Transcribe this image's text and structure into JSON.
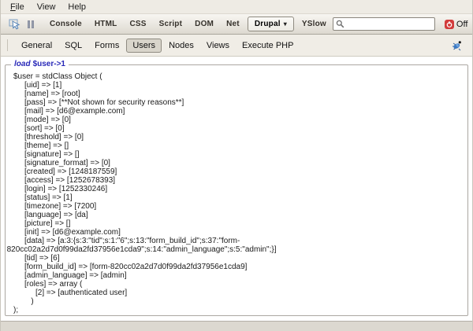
{
  "menu": {
    "items": [
      {
        "label": "File",
        "mnemonic": true
      },
      {
        "label": "View"
      },
      {
        "label": "Help"
      }
    ]
  },
  "firebug_toolbar": {
    "tabs": [
      {
        "label": "Console"
      },
      {
        "label": "HTML"
      },
      {
        "label": "CSS"
      },
      {
        "label": "Script"
      },
      {
        "label": "DOM"
      },
      {
        "label": "Net"
      },
      {
        "label": "Drupal",
        "active": true,
        "dropdown": true
      },
      {
        "label": "YSlow"
      }
    ],
    "search_placeholder": "",
    "search_value": "",
    "off_label": "Off",
    "icons": [
      "inspect-icon",
      "pause-icon",
      "search-icon",
      "power-off-icon"
    ]
  },
  "drupal_toolbar": {
    "tabs": [
      {
        "label": "General"
      },
      {
        "label": "SQL"
      },
      {
        "label": "Forms"
      },
      {
        "label": "Users",
        "active": true
      },
      {
        "label": "Nodes"
      },
      {
        "label": "Views"
      },
      {
        "label": "Execute PHP"
      }
    ],
    "icons": [
      "drupal-bug-icon"
    ]
  },
  "output": {
    "legend_keyword": "load",
    "legend_object": "$user->1",
    "lines": [
      {
        "indent": 0,
        "text": "$user = stdClass Object ("
      },
      {
        "indent": 1,
        "text": "[uid] => [1]"
      },
      {
        "indent": 1,
        "text": "[name] => [root]"
      },
      {
        "indent": 1,
        "text": "[pass] => [**Not shown for security reasons**]"
      },
      {
        "indent": 1,
        "text": "[mail] => [d6@example.com]"
      },
      {
        "indent": 1,
        "text": "[mode] => [0]"
      },
      {
        "indent": 1,
        "text": "[sort] => [0]"
      },
      {
        "indent": 1,
        "text": "[threshold] => [0]"
      },
      {
        "indent": 1,
        "text": "[theme] => []"
      },
      {
        "indent": 1,
        "text": "[signature] => []"
      },
      {
        "indent": 1,
        "text": "[signature_format] => [0]"
      },
      {
        "indent": 1,
        "text": "[created] => [1248187559]"
      },
      {
        "indent": 1,
        "text": "[access] => [1252678393]"
      },
      {
        "indent": 1,
        "text": "[login] => [1252330246]"
      },
      {
        "indent": 1,
        "text": "[status] => [1]"
      },
      {
        "indent": 1,
        "text": "[timezone] => [7200]"
      },
      {
        "indent": 1,
        "text": "[language] => [da]"
      },
      {
        "indent": 1,
        "text": "[picture] => []"
      },
      {
        "indent": 1,
        "text": "[init] => [d6@example.com]"
      },
      {
        "indent": 1,
        "text": "[data] => [a:3:{s:3:\"tid\";s:1:\"6\";s:13:\"form_build_id\";s:37:\"form-"
      },
      {
        "indent": -0.6,
        "text": "820cc02a2d7d0f99da2fd37956e1cda9\";s:14:\"admin_language\";s:5:\"admin\";}]"
      },
      {
        "indent": 1,
        "text": "[tid] => [6]"
      },
      {
        "indent": 1,
        "text": "[form_build_id] => [form-820cc02a2d7d0f99da2fd37956e1cda9]"
      },
      {
        "indent": 1,
        "text": "[admin_language] => [admin]"
      },
      {
        "indent": 1,
        "text": "[roles] => array ("
      },
      {
        "indent": 2,
        "text": "[2] => [authenticated user]"
      },
      {
        "indent": 1.6,
        "text": ")"
      },
      {
        "indent": 0,
        "text": ");"
      }
    ]
  },
  "colors": {
    "legend_blue": "#2828b8",
    "off_red": "#d23b3b",
    "bug_blue": "#3b78c3"
  }
}
